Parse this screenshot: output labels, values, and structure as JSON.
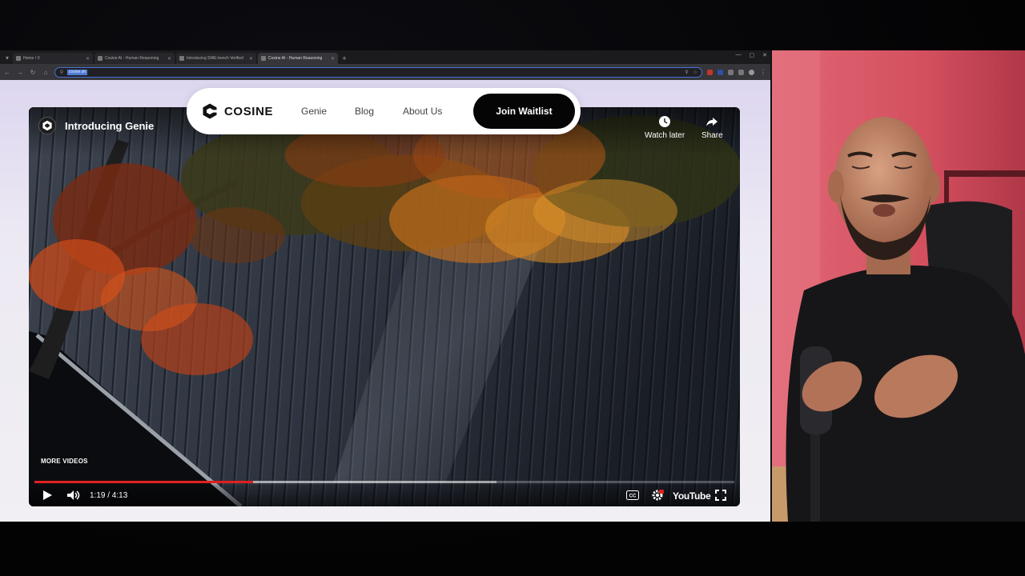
{
  "browser": {
    "tabs": [
      {
        "title": "Home / X",
        "active": false
      },
      {
        "title": "Cosine AI - Human Reasoning",
        "active": false
      },
      {
        "title": "Introducing SWE-bench Verified",
        "active": false
      },
      {
        "title": "Cosine AI - Human Reasoning",
        "active": true
      }
    ],
    "new_tab_label": "+",
    "address_text": "cosine.sh"
  },
  "cosine_nav": {
    "brand": "COSINE",
    "links": [
      "Genie",
      "Blog",
      "About Us"
    ],
    "cta": "Join Waitlist"
  },
  "video": {
    "title": "Introducing Genie",
    "watch_later": "Watch later",
    "share": "Share",
    "more_videos": "MORE VIDEOS",
    "time": "1:19 / 4:13",
    "played_fraction": 0.312,
    "buffered_fraction": 0.66,
    "youtube": "YouTube",
    "progress_color": "#e02020"
  },
  "webcam": {
    "background_color": "#d9576a"
  }
}
